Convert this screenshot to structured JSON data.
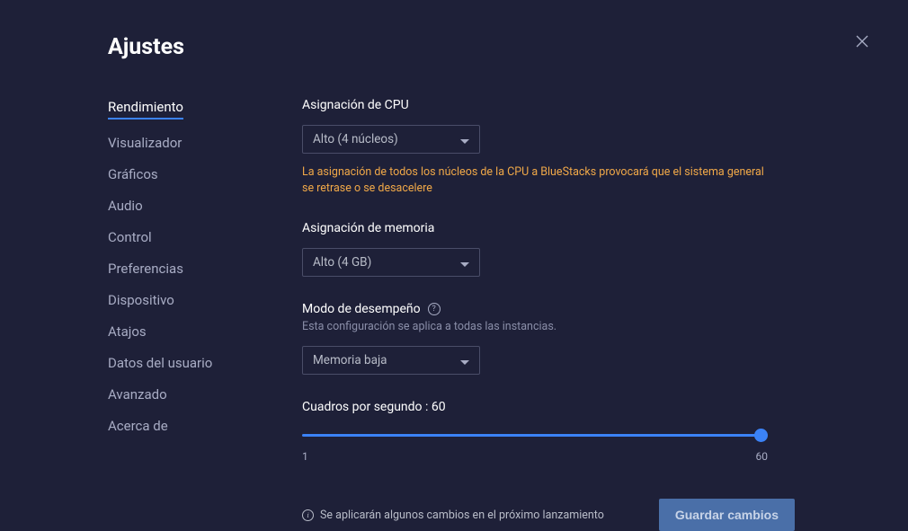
{
  "title": "Ajustes",
  "sidebar": {
    "items": [
      {
        "label": "Rendimiento",
        "active": true
      },
      {
        "label": "Visualizador",
        "active": false
      },
      {
        "label": "Gráficos",
        "active": false
      },
      {
        "label": "Audio",
        "active": false
      },
      {
        "label": "Control",
        "active": false
      },
      {
        "label": "Preferencias",
        "active": false
      },
      {
        "label": "Dispositivo",
        "active": false
      },
      {
        "label": "Atajos",
        "active": false
      },
      {
        "label": "Datos del usuario",
        "active": false
      },
      {
        "label": "Avanzado",
        "active": false
      },
      {
        "label": "Acerca de",
        "active": false
      }
    ]
  },
  "cpu": {
    "label": "Asignación de CPU",
    "value": "Alto (4 núcleos)",
    "warning": "La asignación de todos los núcleos de la CPU a BlueStacks provocará que el sistema general se retrase o se desacelere"
  },
  "memory": {
    "label": "Asignación de memoria",
    "value": "Alto (4 GB)"
  },
  "performance": {
    "label": "Modo de desempeño",
    "sublabel": "Esta configuración se aplica a todas las instancias.",
    "value": "Memoria baja"
  },
  "fps": {
    "label_prefix": "Cuadros por segundo : ",
    "value": "60",
    "min": "1",
    "max": "60"
  },
  "footer": {
    "info": "Se aplicarán algunos cambios en el próximo lanzamiento",
    "save_label": "Guardar cambios"
  }
}
